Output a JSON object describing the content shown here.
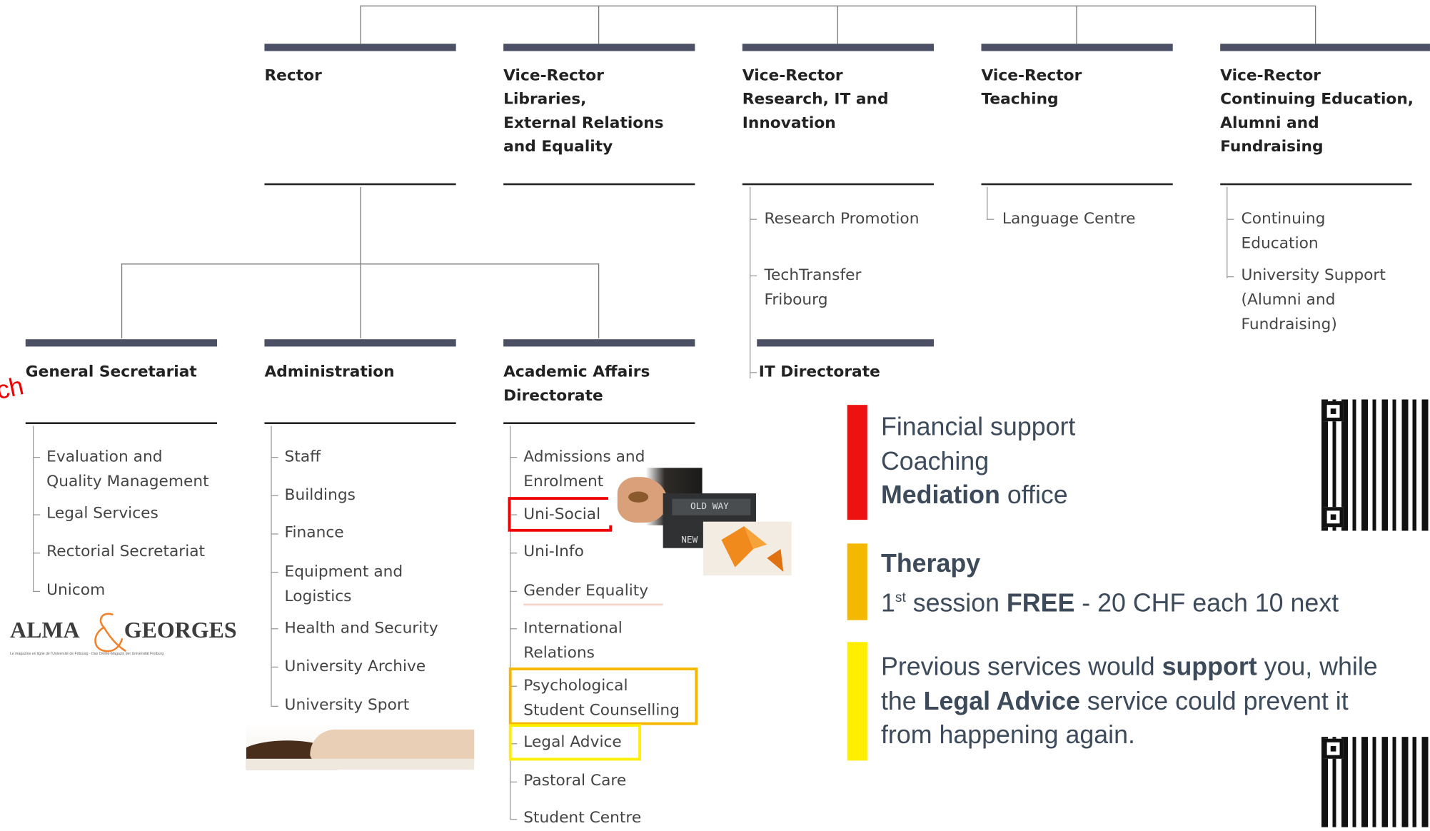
{
  "corner_fragment": "ch",
  "top_level": [
    {
      "title": "Rector"
    },
    {
      "title": "Vice-Rector\nLibraries,\nExternal Relations\nand Equality"
    },
    {
      "title": "Vice-Rector\nResearch, IT and\nInnovation"
    },
    {
      "title": "Vice-Rector\nTeaching"
    },
    {
      "title": "Vice-Rector\nContinuing Education,\nAlumni and\nFundraising"
    }
  ],
  "research_items": [
    "Research Promotion",
    "TechTransfer\nFribourg"
  ],
  "teaching_items": [
    "Language Centre"
  ],
  "continuing_items": [
    "Continuing\nEducation",
    "University Support\n(Alumni and\nFundraising)"
  ],
  "it_directorate": "IT Directorate",
  "second_level": [
    {
      "title": "General Secretariat"
    },
    {
      "title": "Administration"
    },
    {
      "title": "Academic Affairs\nDirectorate"
    }
  ],
  "general_items": [
    "Evaluation and\nQuality Management",
    "Legal Services",
    "Rectorial Secretariat",
    "Unicom"
  ],
  "admin_items": [
    "Staff",
    "Buildings",
    "Finance",
    "Equipment and\nLogistics",
    "Health and Security",
    "University Archive",
    "University Sport"
  ],
  "academic_items": [
    "Admissions and\nEnrolment",
    "Uni-Social",
    "Uni-Info",
    "Gender Equality",
    "International\nRelations",
    "Psychological\nStudent Counselling",
    "Legal Advice",
    "Pastoral Care",
    "Student Centre"
  ],
  "logo": {
    "left": "ALMA",
    "right": "GEORGES",
    "tagline": "Le magazine en ligne de l'Université de Fribourg · Das Online-Magazin der Universität Freiburg"
  },
  "photo_labels": {
    "old_way": "OLD WAY",
    "new": "NEW"
  },
  "info": {
    "line1": "Financial support",
    "line2": "Coaching",
    "line3_bold": "Mediation",
    "line3_rest": " office",
    "therapy_title": "Therapy",
    "therapy_num": "1",
    "therapy_sup": "st",
    "therapy_pre": " session ",
    "therapy_free": "FREE",
    "therapy_post": " - 20 CHF each 10 next",
    "p1": "Previous services would ",
    "p1_bold": "support",
    "p1_end": " you, while",
    "p2_start": "the ",
    "p2_bold": "Legal Advice",
    "p2_end": " service could prevent it",
    "p3": "from happening again."
  },
  "colors": {
    "red": "#ee1111",
    "orange": "#f5b800",
    "yellow": "#ffee00",
    "bar": "#4b5065",
    "text": "#3c4a5a"
  }
}
